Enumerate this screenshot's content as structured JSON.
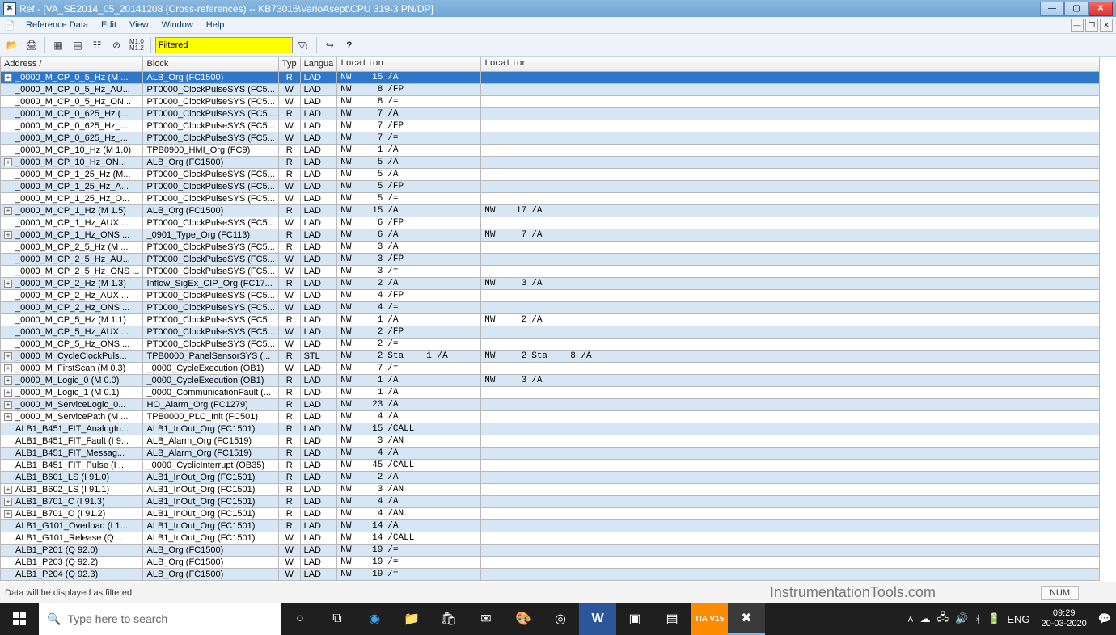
{
  "window": {
    "title": "Ref - [VA_SE2014_05_20141208 (Cross-references) -- KB73016\\VarioAsept\\CPU 319-3 PN/DP]"
  },
  "menu": {
    "items": [
      "Reference Data",
      "Edit",
      "View",
      "Window",
      "Help"
    ]
  },
  "toolbar": {
    "filter_value": "Filtered"
  },
  "columns": [
    "Address  /",
    "Block",
    "Typ",
    "Langua",
    "Location",
    "Location"
  ],
  "rows": [
    {
      "exp": "+",
      "addr": "_0000_M_CP_0_5_Hz (M ...",
      "block": "ALB_Org (FC1500)",
      "typ": "R",
      "lang": "LAD",
      "loc1": {
        "nw": "NW",
        "n": "15",
        "op": "/A"
      },
      "sel": true
    },
    {
      "exp": "",
      "addr": "_0000_M_CP_0_5_Hz_AU...",
      "block": "PT0000_ClockPulseSYS (FC5...",
      "typ": "W",
      "lang": "LAD",
      "loc1": {
        "nw": "NW",
        "n": "8",
        "op": "/FP"
      }
    },
    {
      "exp": "",
      "addr": "_0000_M_CP_0_5_Hz_ON...",
      "block": "PT0000_ClockPulseSYS (FC5...",
      "typ": "W",
      "lang": "LAD",
      "loc1": {
        "nw": "NW",
        "n": "8",
        "op": "/="
      }
    },
    {
      "exp": "",
      "addr": "_0000_M_CP_0_625_Hz (...",
      "block": "PT0000_ClockPulseSYS (FC5...",
      "typ": "R",
      "lang": "LAD",
      "loc1": {
        "nw": "NW",
        "n": "7",
        "op": "/A"
      }
    },
    {
      "exp": "",
      "addr": "_0000_M_CP_0_625_Hz_...",
      "block": "PT0000_ClockPulseSYS (FC5...",
      "typ": "W",
      "lang": "LAD",
      "loc1": {
        "nw": "NW",
        "n": "7",
        "op": "/FP"
      }
    },
    {
      "exp": "",
      "addr": "_0000_M_CP_0_625_Hz_...",
      "block": "PT0000_ClockPulseSYS (FC5...",
      "typ": "W",
      "lang": "LAD",
      "loc1": {
        "nw": "NW",
        "n": "7",
        "op": "/="
      }
    },
    {
      "exp": "",
      "addr": "_0000_M_CP_10_Hz (M 1.0)",
      "block": "TPB0900_HMI_Org (FC9)",
      "typ": "R",
      "lang": "LAD",
      "loc1": {
        "nw": "NW",
        "n": "1",
        "op": "/A"
      }
    },
    {
      "exp": "+",
      "addr": "_0000_M_CP_10_Hz_ON...",
      "block": "ALB_Org (FC1500)",
      "typ": "R",
      "lang": "LAD",
      "loc1": {
        "nw": "NW",
        "n": "5",
        "op": "/A"
      }
    },
    {
      "exp": "",
      "addr": "_0000_M_CP_1_25_Hz (M...",
      "block": "PT0000_ClockPulseSYS (FC5...",
      "typ": "R",
      "lang": "LAD",
      "loc1": {
        "nw": "NW",
        "n": "5",
        "op": "/A"
      }
    },
    {
      "exp": "",
      "addr": "_0000_M_CP_1_25_Hz_A...",
      "block": "PT0000_ClockPulseSYS (FC5...",
      "typ": "W",
      "lang": "LAD",
      "loc1": {
        "nw": "NW",
        "n": "5",
        "op": "/FP"
      }
    },
    {
      "exp": "",
      "addr": "_0000_M_CP_1_25_Hz_O...",
      "block": "PT0000_ClockPulseSYS (FC5...",
      "typ": "W",
      "lang": "LAD",
      "loc1": {
        "nw": "NW",
        "n": "5",
        "op": "/="
      }
    },
    {
      "exp": "+",
      "addr": "_0000_M_CP_1_Hz (M 1.5)",
      "block": "ALB_Org (FC1500)",
      "typ": "R",
      "lang": "LAD",
      "loc1": {
        "nw": "NW",
        "n": "15",
        "op": "/A"
      },
      "loc2": {
        "nw": "NW",
        "n": "17",
        "op": "/A"
      }
    },
    {
      "exp": "",
      "addr": "_0000_M_CP_1_Hz_AUX ...",
      "block": "PT0000_ClockPulseSYS (FC5...",
      "typ": "W",
      "lang": "LAD",
      "loc1": {
        "nw": "NW",
        "n": "6",
        "op": "/FP"
      }
    },
    {
      "exp": "+",
      "addr": "_0000_M_CP_1_Hz_ONS ...",
      "block": "_0901_Type_Org (FC113)",
      "typ": "R",
      "lang": "LAD",
      "loc1": {
        "nw": "NW",
        "n": "6",
        "op": "/A"
      },
      "loc2": {
        "nw": "NW",
        "n": "7",
        "op": "/A"
      }
    },
    {
      "exp": "",
      "addr": "_0000_M_CP_2_5_Hz (M ...",
      "block": "PT0000_ClockPulseSYS (FC5...",
      "typ": "R",
      "lang": "LAD",
      "loc1": {
        "nw": "NW",
        "n": "3",
        "op": "/A"
      }
    },
    {
      "exp": "",
      "addr": "_0000_M_CP_2_5_Hz_AU...",
      "block": "PT0000_ClockPulseSYS (FC5...",
      "typ": "W",
      "lang": "LAD",
      "loc1": {
        "nw": "NW",
        "n": "3",
        "op": "/FP"
      }
    },
    {
      "exp": "",
      "addr": "_0000_M_CP_2_5_Hz_ONS ...",
      "block": "PT0000_ClockPulseSYS (FC5...",
      "typ": "W",
      "lang": "LAD",
      "loc1": {
        "nw": "NW",
        "n": "3",
        "op": "/="
      }
    },
    {
      "exp": "+",
      "addr": "_0000_M_CP_2_Hz (M 1.3)",
      "block": "Inflow_SigEx_CIP_Org (FC17...",
      "typ": "R",
      "lang": "LAD",
      "loc1": {
        "nw": "NW",
        "n": "2",
        "op": "/A"
      },
      "loc2": {
        "nw": "NW",
        "n": "3",
        "op": "/A"
      }
    },
    {
      "exp": "",
      "addr": "_0000_M_CP_2_Hz_AUX ...",
      "block": "PT0000_ClockPulseSYS (FC5...",
      "typ": "W",
      "lang": "LAD",
      "loc1": {
        "nw": "NW",
        "n": "4",
        "op": "/FP"
      }
    },
    {
      "exp": "",
      "addr": "_0000_M_CP_2_Hz_ONS ...",
      "block": "PT0000_ClockPulseSYS (FC5...",
      "typ": "W",
      "lang": "LAD",
      "loc1": {
        "nw": "NW",
        "n": "4",
        "op": "/="
      }
    },
    {
      "exp": "",
      "addr": "_0000_M_CP_5_Hz (M 1.1)",
      "block": "PT0000_ClockPulseSYS (FC5...",
      "typ": "R",
      "lang": "LAD",
      "loc1": {
        "nw": "NW",
        "n": "1",
        "op": "/A"
      },
      "loc2": {
        "nw": "NW",
        "n": "2",
        "op": "/A"
      }
    },
    {
      "exp": "",
      "addr": "_0000_M_CP_5_Hz_AUX ...",
      "block": "PT0000_ClockPulseSYS (FC5...",
      "typ": "W",
      "lang": "LAD",
      "loc1": {
        "nw": "NW",
        "n": "2",
        "op": "/FP"
      }
    },
    {
      "exp": "",
      "addr": "_0000_M_CP_5_Hz_ONS ...",
      "block": "PT0000_ClockPulseSYS (FC5...",
      "typ": "W",
      "lang": "LAD",
      "loc1": {
        "nw": "NW",
        "n": "2",
        "op": "/="
      }
    },
    {
      "exp": "+",
      "addr": "_0000_M_CycleClockPuls...",
      "block": "TPB0000_PanelSensorSYS (...",
      "typ": "R",
      "lang": "STL",
      "loc1": {
        "nw": "NW",
        "n": "2",
        "op": "Sta",
        "extra": "1    /A"
      },
      "loc2": {
        "nw": "NW",
        "n": "2",
        "op": "Sta",
        "extra": "8    /A"
      }
    },
    {
      "exp": "+",
      "addr": "_0000_M_FirstScan (M 0.3)",
      "block": "_0000_CycleExecution (OB1)",
      "typ": "W",
      "lang": "LAD",
      "loc1": {
        "nw": "NW",
        "n": "7",
        "op": "/="
      }
    },
    {
      "exp": "+",
      "addr": "_0000_M_Logic_0 (M 0.0)",
      "block": "_0000_CycleExecution (OB1)",
      "typ": "R",
      "lang": "LAD",
      "loc1": {
        "nw": "NW",
        "n": "1",
        "op": "/A"
      },
      "loc2": {
        "nw": "NW",
        "n": "3",
        "op": "/A"
      }
    },
    {
      "exp": "+",
      "addr": "_0000_M_Logic_1 (M 0.1)",
      "block": "_0000_CommunicationFault (...",
      "typ": "R",
      "lang": "LAD",
      "loc1": {
        "nw": "NW",
        "n": "1",
        "op": "/A"
      }
    },
    {
      "exp": "+",
      "addr": "_0000_M_ServiceLogic_0...",
      "block": "HO_Alarm_Org (FC1279)",
      "typ": "R",
      "lang": "LAD",
      "loc1": {
        "nw": "NW",
        "n": "23",
        "op": "/A"
      }
    },
    {
      "exp": "+",
      "addr": "_0000_M_ServicePath (M ...",
      "block": "TPB0000_PLC_Init (FC501)",
      "typ": "R",
      "lang": "LAD",
      "loc1": {
        "nw": "NW",
        "n": "4",
        "op": "/A"
      }
    },
    {
      "exp": "",
      "addr": "ALB1_B451_FIT_AnalogIn...",
      "block": "ALB1_InOut_Org (FC1501)",
      "typ": "R",
      "lang": "LAD",
      "loc1": {
        "nw": "NW",
        "n": "15",
        "op": "/CALL"
      }
    },
    {
      "exp": "",
      "addr": "ALB1_B451_FIT_Fault (I 9...",
      "block": "ALB_Alarm_Org (FC1519)",
      "typ": "R",
      "lang": "LAD",
      "loc1": {
        "nw": "NW",
        "n": "3",
        "op": "/AN"
      }
    },
    {
      "exp": "",
      "addr": "ALB1_B451_FIT_Messag...",
      "block": "ALB_Alarm_Org (FC1519)",
      "typ": "R",
      "lang": "LAD",
      "loc1": {
        "nw": "NW",
        "n": "4",
        "op": "/A"
      }
    },
    {
      "exp": "",
      "addr": "ALB1_B451_FIT_Pulse (I ...",
      "block": "_0000_CyclicInterrupt (OB35)",
      "typ": "R",
      "lang": "LAD",
      "loc1": {
        "nw": "NW",
        "n": "45",
        "op": "/CALL"
      }
    },
    {
      "exp": "",
      "addr": "ALB1_B601_LS (I 91.0)",
      "block": "ALB1_InOut_Org (FC1501)",
      "typ": "R",
      "lang": "LAD",
      "loc1": {
        "nw": "NW",
        "n": "2",
        "op": "/A"
      }
    },
    {
      "exp": "+",
      "addr": "ALB1_B602_LS (I 91.1)",
      "block": "ALB1_InOut_Org (FC1501)",
      "typ": "R",
      "lang": "LAD",
      "loc1": {
        "nw": "NW",
        "n": "3",
        "op": "/AN"
      }
    },
    {
      "exp": "+",
      "addr": "ALB1_B701_C (I 91.3)",
      "block": "ALB1_InOut_Org (FC1501)",
      "typ": "R",
      "lang": "LAD",
      "loc1": {
        "nw": "NW",
        "n": "4",
        "op": "/A"
      }
    },
    {
      "exp": "+",
      "addr": "ALB1_B701_O (I 91.2)",
      "block": "ALB1_InOut_Org (FC1501)",
      "typ": "R",
      "lang": "LAD",
      "loc1": {
        "nw": "NW",
        "n": "4",
        "op": "/AN"
      }
    },
    {
      "exp": "",
      "addr": "ALB1_G101_Overload (I 1...",
      "block": "ALB1_InOut_Org (FC1501)",
      "typ": "R",
      "lang": "LAD",
      "loc1": {
        "nw": "NW",
        "n": "14",
        "op": "/A"
      }
    },
    {
      "exp": "",
      "addr": "ALB1_G101_Release (Q ...",
      "block": "ALB1_InOut_Org (FC1501)",
      "typ": "W",
      "lang": "LAD",
      "loc1": {
        "nw": "NW",
        "n": "14",
        "op": "/CALL"
      }
    },
    {
      "exp": "",
      "addr": "ALB1_P201 (Q 92.0)",
      "block": "ALB_Org (FC1500)",
      "typ": "W",
      "lang": "LAD",
      "loc1": {
        "nw": "NW",
        "n": "19",
        "op": "/="
      }
    },
    {
      "exp": "",
      "addr": "ALB1_P203 (Q 92.2)",
      "block": "ALB_Org (FC1500)",
      "typ": "W",
      "lang": "LAD",
      "loc1": {
        "nw": "NW",
        "n": "19",
        "op": "/="
      }
    },
    {
      "exp": "",
      "addr": "ALB1_P204 (Q 92.3)",
      "block": "ALB_Org (FC1500)",
      "typ": "W",
      "lang": "LAD",
      "loc1": {
        "nw": "NW",
        "n": "19",
        "op": "/="
      }
    }
  ],
  "status": {
    "msg": "Data will be displayed as filtered.",
    "watermark": "InstrumentationTools.com",
    "num": "NUM"
  },
  "taskbar": {
    "search_placeholder": "Type here to search",
    "lang": "ENG",
    "time": "09:29",
    "date": "20-03-2020",
    "tia": "TIA\nV15"
  }
}
